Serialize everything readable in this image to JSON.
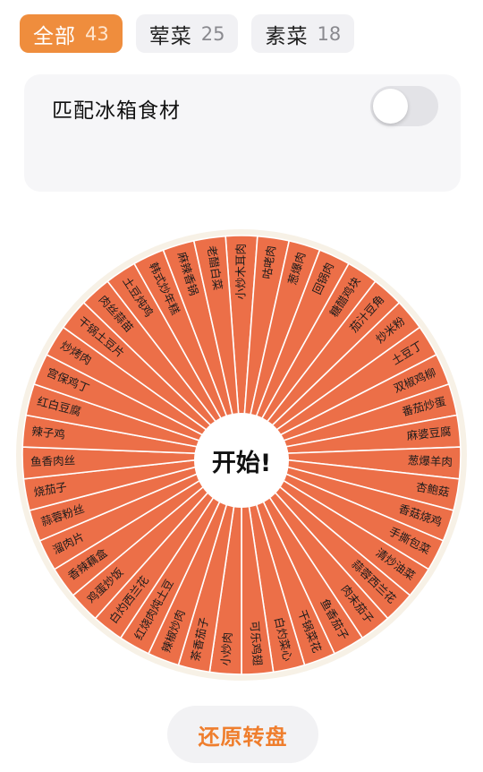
{
  "filters": [
    {
      "label": "全部",
      "count": "43",
      "active": true
    },
    {
      "label": "荤菜",
      "count": "25",
      "active": false
    },
    {
      "label": "素菜",
      "count": "18",
      "active": false
    }
  ],
  "fridge_match": {
    "label": "匹配冰箱食材",
    "enabled": false
  },
  "wheel": {
    "center_label": "开始!",
    "segment_color": "#ec6f48",
    "items": [
      "小炒木耳肉",
      "咕咾肉",
      "葱爆肉",
      "回锅肉",
      "糖醋鸡块",
      "茄汁豆角",
      "炒米粉",
      "土豆丁",
      "双椒鸡柳",
      "番茄炒蛋",
      "麻婆豆腐",
      "葱爆羊肉",
      "杏鲍菇",
      "香菇烧鸡",
      "手撕包菜",
      "清炒油菜",
      "蒜蓉西兰花",
      "肉末茄子",
      "鱼香茄子",
      "干锅菜花",
      "白灼菜心",
      "可乐鸡翅",
      "小炒肉",
      "茶香茄子",
      "辣椒炒肉",
      "红烧肉炖土豆",
      "白灼西兰花",
      "鸡蛋炒饭",
      "香辣藕盒",
      "溜肉片",
      "蒜蓉粉丝",
      "烧茄子",
      "鱼香肉丝",
      "辣子鸡",
      "红白豆腐",
      "宫保鸡丁",
      "炒烤肉",
      "干锅土豆片",
      "肉丝蒜苗",
      "土豆炖鸡",
      "韩式炒年糕",
      "麻辣香锅",
      "老醋白菜"
    ]
  },
  "reset_label": "还原转盘"
}
